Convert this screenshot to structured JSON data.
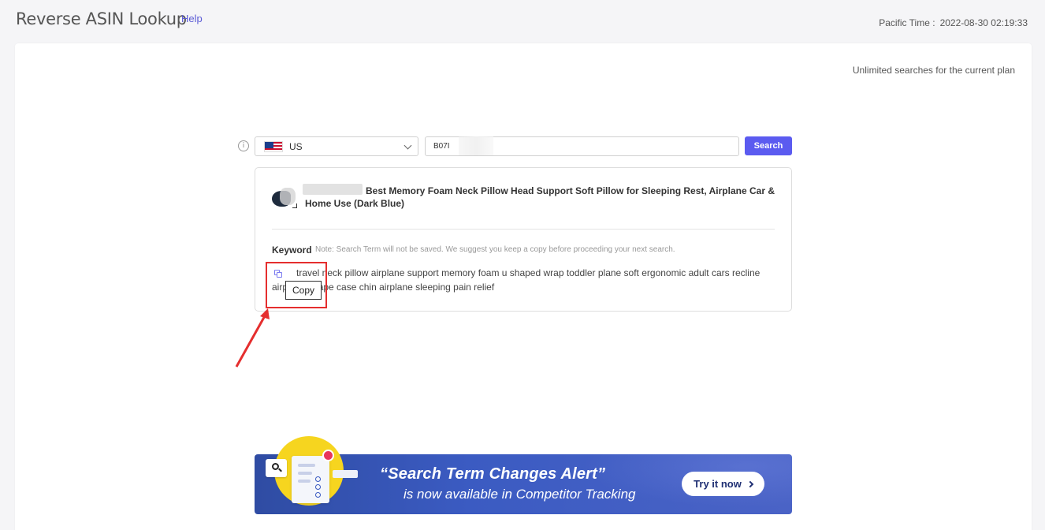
{
  "header": {
    "title": "Reverse ASIN Lookup",
    "help_label": "Help",
    "time_label": "Pacific Time :",
    "time_value": "2022-08-30 02:19:33"
  },
  "plan_note": "Unlimited searches for the current plan",
  "search": {
    "marketplace": "US",
    "asin_value": "B07I",
    "button_label": "Search"
  },
  "result": {
    "product_title": "Best Memory Foam Neck Pillow Head Support Soft Pillow for Sleeping Rest, Airplane Car & Home Use (Dark Blue)",
    "keyword_label": "Keyword",
    "keyword_note": "Note: Search Term will not be saved. We suggest you keep a copy before proceeding your next search.",
    "keywords": "travel neck pillow airplane support memory foam u shaped wrap toddler plane soft ergonomic adult cars recline airplane shape case chin airplane sleeping pain relief",
    "copy_tooltip": "Copy"
  },
  "promo": {
    "headline": "“Search Term Changes Alert”",
    "subline": "is now available in Competitor Tracking",
    "cta_label": "Try it now"
  },
  "colors": {
    "accent": "#5b5bf0",
    "annotation_red": "#e52e2e",
    "banner_blue": "#3b5bc2",
    "banner_yellow": "#f6d51f"
  }
}
